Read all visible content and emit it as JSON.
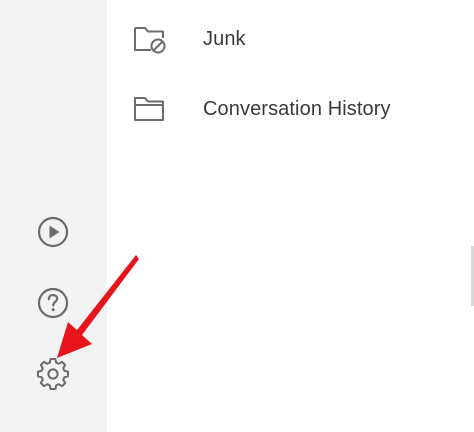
{
  "folders": [
    {
      "label": "Junk",
      "icon": "junk-folder-icon"
    },
    {
      "label": "Conversation History",
      "icon": "folder-icon"
    }
  ],
  "rail": {
    "items": [
      {
        "name": "play-icon"
      },
      {
        "name": "help-icon"
      },
      {
        "name": "gear-icon"
      }
    ]
  },
  "colors": {
    "rail_bg": "#f3f3f3",
    "icon_stroke": "#6b6b6b",
    "text": "#3a3a3a",
    "arrow": "#e8141c"
  }
}
